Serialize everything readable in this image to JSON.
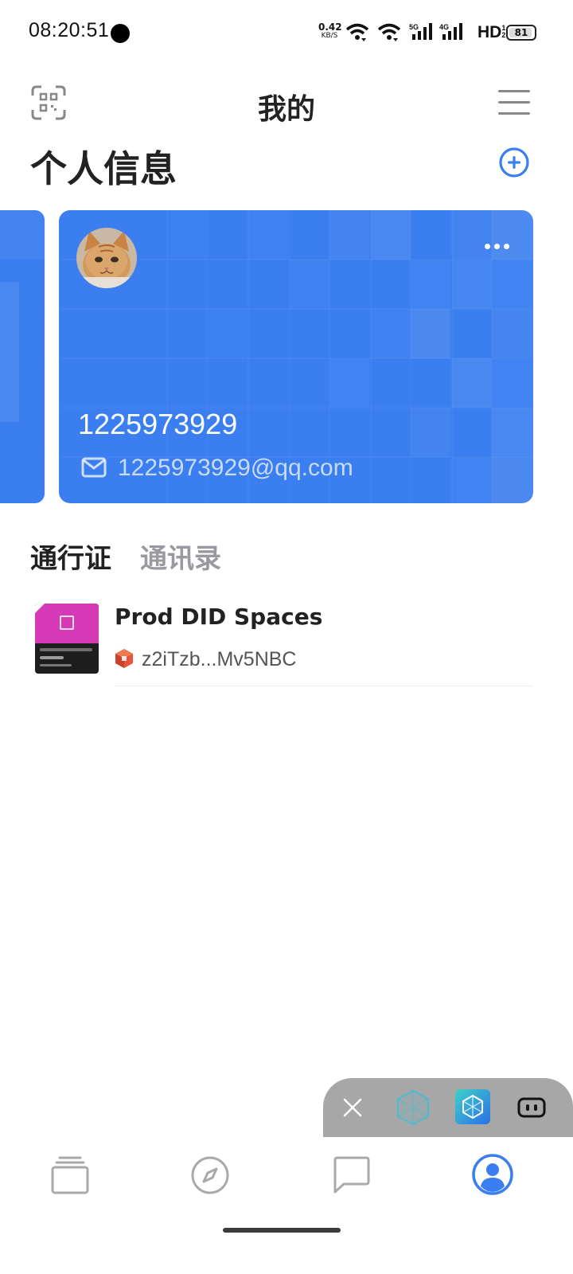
{
  "status_bar": {
    "time": "08:20:51",
    "net_speed_value": "0.42",
    "net_speed_unit": "KB/S",
    "network_5g": "5G",
    "network_4g": "4G",
    "hd_label": "HD",
    "hd_sub": "1 2",
    "battery": "81"
  },
  "header": {
    "title": "我的"
  },
  "profile": {
    "section_title": "个人信息",
    "card": {
      "name": "1225973929",
      "email": "1225973929@qq.com"
    }
  },
  "tabs": [
    {
      "label": "通行证",
      "active": true
    },
    {
      "label": "通讯录",
      "active": false
    }
  ],
  "passports": [
    {
      "name": "Prod DID Spaces",
      "did": "z2iTzb...Mv5NBC"
    }
  ],
  "floating_panel": {
    "icons": [
      "close-icon",
      "arcblock-app-icon",
      "did-wallet-app-icon",
      "chat-bubble-app-icon"
    ]
  },
  "bottom_nav": {
    "items": [
      "cards-icon",
      "discover-icon",
      "messages-icon",
      "profile-icon"
    ],
    "active": "profile-icon"
  },
  "colors": {
    "accent": "#3a7ef0",
    "text_primary": "#222222",
    "text_muted": "#999aa0"
  }
}
